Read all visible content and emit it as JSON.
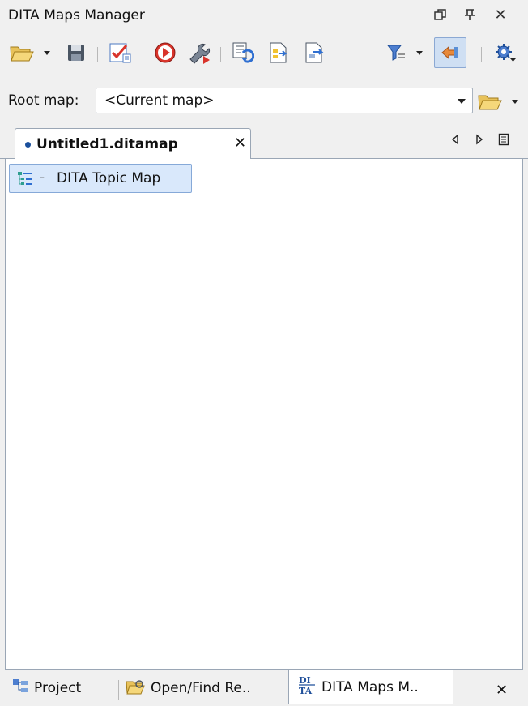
{
  "window": {
    "title": "DITA Maps Manager",
    "controls": {
      "restore_icon": "restore-icon",
      "pin_icon": "pin-icon",
      "close_glyph": "✕"
    }
  },
  "toolbar": {
    "items": [
      "open-folder-icon",
      "dropdown-arrow-icon",
      "save-icon",
      "validate-icon",
      "apply-transformation-icon",
      "configure-transformation-icon",
      "refactoring-icon",
      "open-map-icon",
      "export-map-icon",
      "filter-icon",
      "link-with-editor-icon",
      "settings-icon"
    ]
  },
  "root_map": {
    "label": "Root map:",
    "value": "<Current map>"
  },
  "tabs": {
    "active": {
      "name": "Untitled1.ditamap",
      "close": "✕",
      "modified_dot_color": "#1a4f9c"
    }
  },
  "tree": {
    "root": {
      "dash": "-",
      "label": "DITA Topic Map"
    }
  },
  "bottom_tabs": [
    {
      "label": "Project"
    },
    {
      "label": "Open/Find Re.."
    },
    {
      "label": "DITA Maps M..",
      "icon_text": "DI TA"
    }
  ],
  "bottom_close": "✕",
  "colors": {
    "accent": "#1a4f9c",
    "selection": "#d9e8fb",
    "red": "#d9342b"
  }
}
